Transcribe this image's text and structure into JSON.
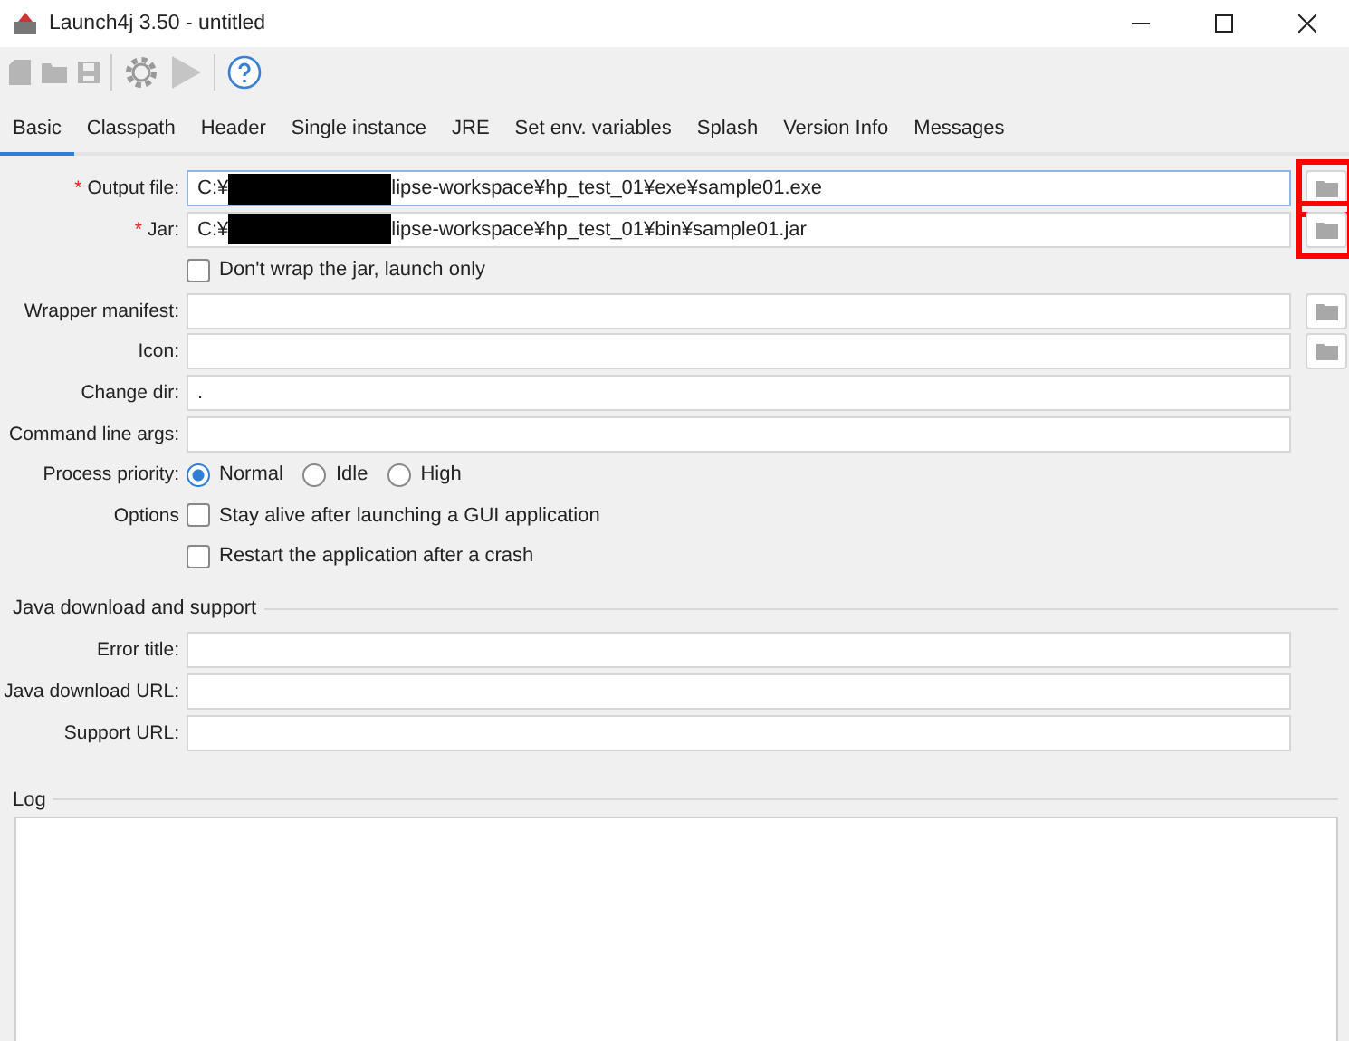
{
  "window": {
    "title": "Launch4j 3.50 - untitled"
  },
  "tabs": [
    {
      "label": "Basic",
      "selected": true
    },
    {
      "label": "Classpath",
      "selected": false
    },
    {
      "label": "Header",
      "selected": false
    },
    {
      "label": "Single instance",
      "selected": false
    },
    {
      "label": "JRE",
      "selected": false
    },
    {
      "label": "Set env. variables",
      "selected": false
    },
    {
      "label": "Splash",
      "selected": false
    },
    {
      "label": "Version Info",
      "selected": false
    },
    {
      "label": "Messages",
      "selected": false
    }
  ],
  "form": {
    "rows": [
      {
        "kind": "field",
        "required_mark": "*",
        "label": "Output file:",
        "focused": true,
        "value": "C:¥",
        "redacted": true,
        "value_after": "lipse-workspace¥hp_test_01¥exe¥sample01.exe",
        "browse": true,
        "browse_highlighted": true
      },
      {
        "kind": "field",
        "required_mark": "*",
        "label": "Jar:",
        "focused": false,
        "value": "C:¥",
        "redacted": true,
        "value_after": "lipse-workspace¥hp_test_01¥bin¥sample01.jar",
        "browse": true,
        "browse_highlighted": true
      },
      {
        "kind": "checkbox",
        "text": "Don't wrap the jar, launch only",
        "checked": false
      },
      {
        "kind": "field",
        "label": "Wrapper manifest:",
        "focused": false,
        "browse": true
      },
      {
        "kind": "field",
        "label": "Icon:",
        "focused": false,
        "browse": true
      },
      {
        "kind": "field",
        "label": "Change dir:",
        "focused": false,
        "value": "."
      },
      {
        "kind": "field",
        "label": "Command line args:",
        "focused": false
      },
      {
        "kind": "radio",
        "label": "Process priority:",
        "options": [
          {
            "text": "Normal",
            "selected": true
          },
          {
            "text": "Idle",
            "selected": false
          },
          {
            "text": "High",
            "selected": false
          }
        ]
      },
      {
        "kind": "checkbox",
        "label": "Options",
        "text": "Stay alive after launching a GUI application",
        "checked": false
      },
      {
        "kind": "checkbox",
        "text": "Restart the application after a crash",
        "checked": false
      }
    ]
  },
  "java_download": {
    "title": "Java download and support",
    "rows": [
      {
        "kind": "field",
        "label": "Error title:",
        "focused": false
      },
      {
        "kind": "field",
        "label": "Java download URL:",
        "focused": false
      },
      {
        "kind": "field",
        "label": "Support URL:",
        "focused": false
      }
    ]
  },
  "log": {
    "title": "Log"
  }
}
